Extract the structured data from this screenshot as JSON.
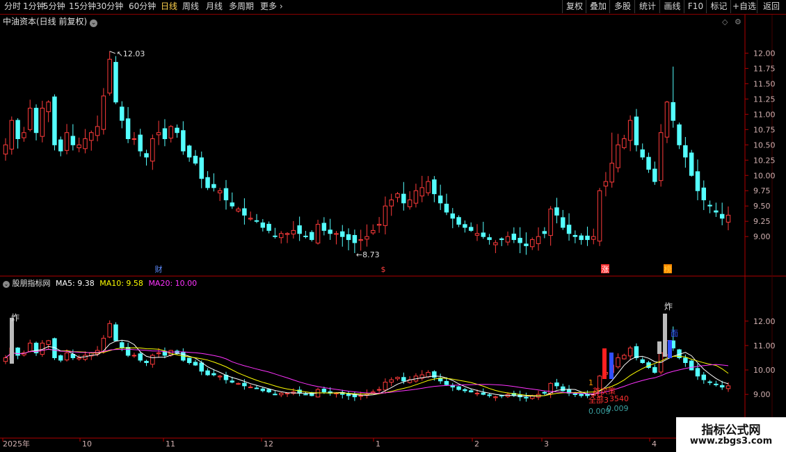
{
  "toolbar": {
    "periods": [
      "分时",
      "1分钟",
      "5分钟",
      "15分钟",
      "30分钟",
      "60分钟",
      "日线",
      "周线",
      "月线",
      "多周期",
      "更多"
    ],
    "active_period": "日线",
    "right_buttons": [
      "复权",
      "叠加",
      "多股",
      "统计",
      "画线",
      "F10",
      "标记",
      "+自选",
      "返回"
    ]
  },
  "main_panel": {
    "title": "中油资本(日线 前复权)",
    "high_label": "12.03",
    "low_label": "8.73",
    "markers": [
      "财",
      "$",
      "涨",
      "榜"
    ]
  },
  "indicator_panel": {
    "name": "股朋指标网",
    "ma5_label": "MA5: 9.38",
    "ma10_label": "MA10: 9.58",
    "ma20_label": "MA20: 10.00",
    "signal_top_left": "炸",
    "signal_top_right": "炸",
    "signal_blue": "面",
    "annotation_1": "1",
    "annotation_2": "首次策",
    "annotation_3": "全部3",
    "annotation_4": "3540",
    "annotation_5": "0.009",
    "annotation_6": "0.009"
  },
  "time_axis": {
    "labels": [
      "2025年",
      "10",
      "11",
      "12",
      "1",
      "2",
      "3",
      "4"
    ]
  },
  "watermark": {
    "line1": "指标公式网",
    "line2": "www.zbgs3.com"
  },
  "colors": {
    "up": "#ff3b3b",
    "down": "#54ffff",
    "ma5": "#ffffff",
    "ma10": "#ffff00",
    "ma20": "#ff33ff",
    "axis": "#b00000"
  },
  "chart_data": {
    "type": "candlestick",
    "title": "中油资本(日线 前复权)",
    "y_axis_main": [
      12.0,
      11.75,
      11.5,
      11.25,
      11.0,
      10.75,
      10.5,
      10.25,
      10.0,
      9.75,
      9.5,
      9.25,
      9.0
    ],
    "y_axis_indicator": [
      12.0,
      11.0,
      10.0,
      9.0
    ],
    "ylim_main": [
      8.57,
      12.38
    ],
    "ylim_indicator": [
      8.52,
      12.62
    ],
    "highest": 12.03,
    "lowest": 8.73,
    "ma_latest": {
      "MA5": 9.38,
      "MA10": 9.58,
      "MA20": 10.0
    },
    "close_path": [
      10.5,
      10.9,
      10.6,
      10.7,
      11.1,
      10.7,
      11.1,
      11.2,
      10.5,
      10.4,
      10.7,
      10.5,
      10.5,
      10.6,
      10.7,
      10.8,
      11.3,
      11.9,
      11.2,
      10.9,
      10.6,
      10.6,
      10.4,
      10.3,
      10.6,
      10.7,
      10.6,
      10.8,
      10.7,
      10.4,
      10.3,
      10.2,
      9.95,
      9.8,
      9.8,
      9.75,
      9.6,
      9.5,
      9.45,
      9.35,
      9.3,
      9.25,
      9.15,
      9.1,
      9.0,
      9.05,
      9.05,
      9.1,
      9.05,
      9.0,
      8.95,
      9.2,
      9.1,
      9.05,
      9.05,
      9.0,
      8.95,
      8.9,
      8.95,
      9.0,
      9.1,
      9.2,
      9.5,
      9.6,
      9.7,
      9.55,
      9.6,
      9.75,
      9.8,
      9.9,
      9.7,
      9.55,
      9.4,
      9.3,
      9.2,
      9.15,
      9.1,
      9.05,
      9.0,
      8.95,
      8.9,
      8.95,
      9.0,
      8.95,
      8.9,
      8.85,
      8.95,
      9.0,
      9.05,
      9.45,
      9.35,
      9.15,
      9.05,
      9.0,
      8.95,
      8.95,
      9.0,
      9.75,
      9.9,
      10.2,
      10.5,
      10.6,
      10.9,
      10.5,
      10.3,
      10.1,
      9.9,
      10.7,
      11.2,
      10.9,
      10.5,
      10.3,
      10.0,
      9.75,
      9.6,
      9.5,
      9.4,
      9.3,
      9.35
    ]
  }
}
